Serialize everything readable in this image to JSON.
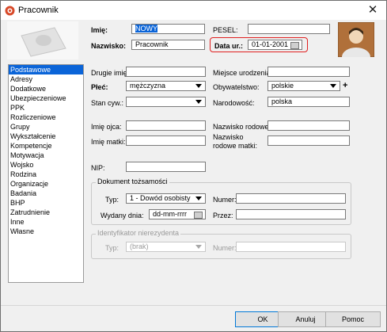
{
  "window": {
    "title": "Pracownik"
  },
  "header": {
    "first_name_label": "Imię:",
    "first_name_value": "NOWY",
    "last_name_label": "Nazwisko:",
    "last_name_value": "Pracownik",
    "pesel_label": "PESEL:",
    "pesel_value": "",
    "birth_date_label": "Data ur.:",
    "birth_date_value": "01-01-2001"
  },
  "sidebar": {
    "items": [
      {
        "label": "Podstawowe"
      },
      {
        "label": "Adresy"
      },
      {
        "label": "Dodatkowe"
      },
      {
        "label": "Ubezpieczeniowe"
      },
      {
        "label": "PPK"
      },
      {
        "label": "Rozliczeniowe"
      },
      {
        "label": "Grupy"
      },
      {
        "label": "Wykształcenie"
      },
      {
        "label": "Kompetencje"
      },
      {
        "label": "Motywacja"
      },
      {
        "label": "Wojsko"
      },
      {
        "label": "Rodzina"
      },
      {
        "label": "Organizacje"
      },
      {
        "label": "Badania"
      },
      {
        "label": "BHP"
      },
      {
        "label": "Zatrudnienie"
      },
      {
        "label": "Inne"
      },
      {
        "label": "Własne"
      }
    ],
    "selected": "Podstawowe"
  },
  "form": {
    "middle_name_label": "Drugie imię:",
    "middle_name_value": "",
    "birthplace_label": "Miejsce urodzenia:",
    "birthplace_value": "",
    "sex_label": "Płeć:",
    "sex_value": "mężczyzna",
    "citizenship_label": "Obywatelstwo:",
    "citizenship_value": "polskie",
    "add_label": "+",
    "marital_label": "Stan cyw.:",
    "marital_value": "",
    "nationality_label": "Narodowość:",
    "nationality_value": "polska",
    "father_label": "Imię ojca:",
    "father_value": "",
    "family_name_label": "Nazwisko rodowe:",
    "family_name_value": "",
    "mother_label": "Imię matki:",
    "mother_value": "",
    "mother_family_name_label_1": "Nazwisko",
    "mother_family_name_label_2": "rodowe matki:",
    "mother_family_name_value": "",
    "nip_label": "NIP:",
    "nip_value": ""
  },
  "id_document": {
    "legend": "Dokument tożsamości",
    "type_label": "Typ:",
    "type_value": "1 - Dowód osobisty",
    "number_label": "Numer:",
    "number_value": "",
    "issued_label": "Wydany dnia:",
    "issued_value": "dd-mm-rrrr",
    "issuer_label": "Przez:",
    "issuer_value": ""
  },
  "nonresident": {
    "legend": "Identyfikator nierezydenta",
    "type_label": "Typ:",
    "type_value": "(brak)",
    "number_label": "Numer:",
    "number_value": ""
  },
  "buttons": {
    "ok": "OK",
    "cancel": "Anuluj",
    "help": "Pomoc"
  },
  "colors": {
    "selection": "#0a64d8",
    "highlight_border": "#e02020",
    "photo_brown": "#b0703a"
  }
}
